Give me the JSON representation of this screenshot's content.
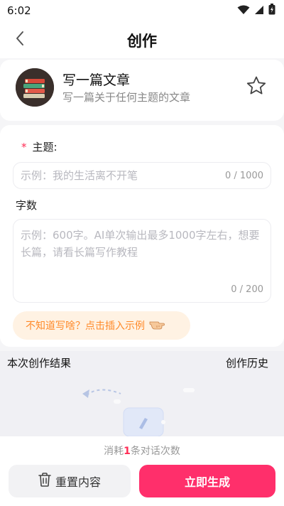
{
  "status_bar": {
    "time": "6:02",
    "icons": [
      "wifi-icon",
      "signal-icon",
      "battery-icon"
    ]
  },
  "header": {
    "title": "创作",
    "back_icon": "chevron-left-icon"
  },
  "template": {
    "title": "写一篇文章",
    "description": "写一篇关于任何主题的文章",
    "avatar_icon": "books-stack-icon",
    "favorite_icon": "star-outline-icon"
  },
  "form": {
    "topic": {
      "required_mark": "*",
      "label": "主题:",
      "placeholder": "示例：我的生活离不开笔",
      "counter": "0 / 1000"
    },
    "word_count": {
      "label": "字数",
      "placeholder": "示例：600字。AI单次输出最多1000字左右，想要长篇，请看长篇写作教程",
      "counter": "0 / 200"
    },
    "example_hint": "不知道写啥？点击插入示例",
    "example_hint_icon": "pointing-hand-icon"
  },
  "results": {
    "title": "本次创作结果",
    "history_label": "创作历史"
  },
  "bottom": {
    "usage_prefix": "消耗",
    "usage_count": "1",
    "usage_suffix": "条对话次数",
    "reset_label": "重置内容",
    "reset_icon": "trash-icon",
    "generate_label": "立即生成"
  },
  "colors": {
    "accent": "#ff2f6b",
    "hint_orange": "#ff8a2a",
    "hint_bg": "#fff2e3",
    "required": "#ff2d55"
  }
}
